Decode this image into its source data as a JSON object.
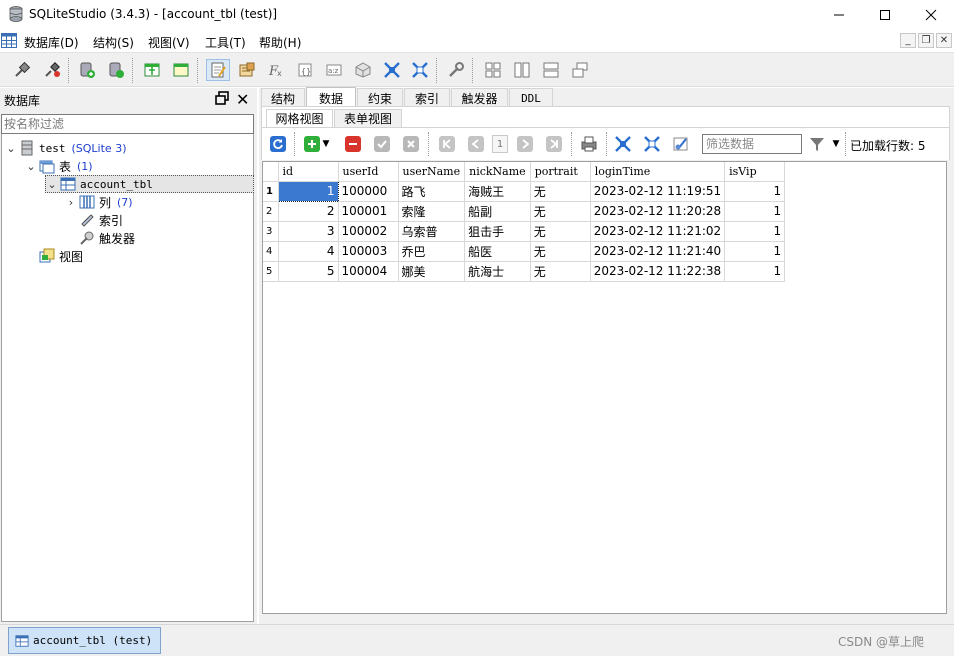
{
  "window": {
    "title": "SQLiteStudio (3.4.3) - [account_tbl (test)]",
    "controls": [
      "minimize",
      "maximize",
      "close"
    ]
  },
  "menu": [
    "数据库(D)",
    "结构(S)",
    "视图(V)",
    "工具(T)",
    "帮助(H)"
  ],
  "toolbar_icons": [
    "connect-icon",
    "disconnect-icon",
    "add-database-icon",
    "edit-database-icon",
    "new-table-icon",
    "edit-table-icon",
    "open-sql-editor-icon",
    "open-history-icon",
    "function-icon",
    "collation-icon",
    "extension-icon",
    "snippet-icon",
    "import-icon",
    "export-icon",
    "settings-icon",
    "tile-icon",
    "tile-vertical-icon",
    "tile-horizontal-icon",
    "cascade-icon"
  ],
  "dock": {
    "title": "数据库",
    "filter_placeholder": "按名称过滤"
  },
  "tree": {
    "database": {
      "name": "test",
      "detail": "(SQLite 3)"
    },
    "tables": {
      "label": "表",
      "count": "(1)"
    },
    "table": {
      "name": "account_tbl"
    },
    "columns": {
      "label": "列",
      "count": "(7)"
    },
    "indexes": {
      "label": "索引"
    },
    "triggers": {
      "label": "触发器"
    },
    "views": {
      "label": "视图"
    }
  },
  "tabs": [
    "结构",
    "数据",
    "约束",
    "索引",
    "触发器",
    "DDL"
  ],
  "active_tab": "数据",
  "subtabs": [
    "网格视图",
    "表单视图"
  ],
  "active_subtab": "网格视图",
  "grid_toolbar": {
    "page_number": "1",
    "filter_placeholder": "筛选数据",
    "rows_loaded_label": "已加载行数: 5"
  },
  "grid": {
    "columns": [
      "id",
      "userId",
      "userName",
      "nickName",
      "portrait",
      "loginTime",
      "isVip"
    ],
    "rows": [
      [
        "1",
        "100000",
        "路飞",
        "海贼王",
        "无",
        "2023-02-12 11:19:51",
        "1"
      ],
      [
        "2",
        "100001",
        "索隆",
        "船副",
        "无",
        "2023-02-12 11:20:28",
        "1"
      ],
      [
        "3",
        "100002",
        "乌索普",
        "狙击手",
        "无",
        "2023-02-12 11:21:02",
        "1"
      ],
      [
        "4",
        "100003",
        "乔巴",
        "船医",
        "无",
        "2023-02-12 11:21:40",
        "1"
      ],
      [
        "5",
        "100004",
        "娜美",
        "航海士",
        "无",
        "2023-02-12 11:22:38",
        "1"
      ]
    ],
    "row_numbers": [
      "1",
      "2",
      "3",
      "4",
      "5"
    ]
  },
  "taskbar": {
    "window_label": "account_tbl (test)"
  },
  "watermark": "CSDN @草上爬",
  "colors": {
    "selection": "#3b78d0",
    "link_blue": "#1d3fcf",
    "add_green": "#2fae3a",
    "delete_red": "#d9342b",
    "active_task": "#cfe3f8"
  }
}
